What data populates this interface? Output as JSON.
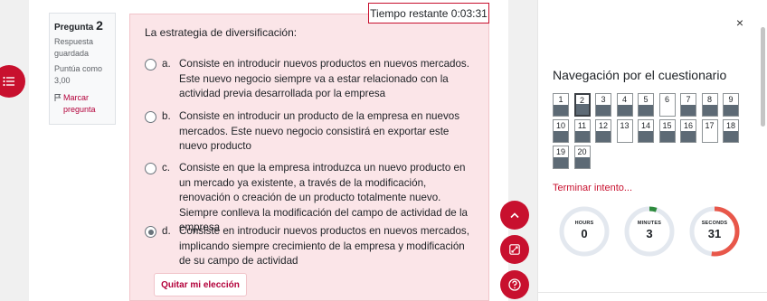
{
  "question_info": {
    "pregunta_label": "Pregunta",
    "number": "2",
    "status": "Respuesta guardada",
    "score": "Puntúa como 3,00",
    "flag_label": "Marcar pregunta"
  },
  "timer": "Tiempo restante 0:03:31",
  "question": {
    "text": "La estrategia de diversificación:",
    "answers": [
      {
        "letter": "a.",
        "text": "Consiste en introducir nuevos productos en nuevos mercados. Este nuevo negocio siempre va a estar relacionado con la actividad previa desarrollada por la empresa",
        "checked": false
      },
      {
        "letter": "b.",
        "text": "Consiste en introducir un producto de la empresa en nuevos mercados. Este nuevo negocio consistirá en exportar este nuevo producto",
        "checked": false
      },
      {
        "letter": "c.",
        "text": "Consiste en que la empresa introduzca un nuevo producto en un mercado ya existente, a través de la modificación, renovación o creación de un producto totalmente nuevo. Siempre conlleva la modificación del campo de actividad de la empresa",
        "checked": false
      },
      {
        "letter": "d.",
        "text": "Consiste en introducir nuevos productos en nuevos mercados, implicando siempre crecimiento de la empresa y modificación de su campo de actividad",
        "checked": true
      }
    ],
    "clear_label": "Quitar mi elección"
  },
  "drawer": {
    "close_glyph": "×",
    "title": "Navegación por el cuestionario",
    "nav": [
      {
        "n": "1",
        "answered": true
      },
      {
        "n": "2",
        "answered": true,
        "current": true
      },
      {
        "n": "3",
        "answered": true
      },
      {
        "n": "4",
        "answered": true
      },
      {
        "n": "5",
        "answered": true
      },
      {
        "n": "6",
        "answered": false
      },
      {
        "n": "7",
        "answered": true
      },
      {
        "n": "8",
        "answered": true
      },
      {
        "n": "9",
        "answered": true
      },
      {
        "n": "10",
        "answered": true
      },
      {
        "n": "11",
        "answered": true
      },
      {
        "n": "12",
        "answered": true
      },
      {
        "n": "13",
        "answered": false
      },
      {
        "n": "14",
        "answered": true
      },
      {
        "n": "15",
        "answered": true
      },
      {
        "n": "16",
        "answered": true
      },
      {
        "n": "17",
        "answered": false
      },
      {
        "n": "18",
        "answered": true
      },
      {
        "n": "19",
        "answered": true
      },
      {
        "n": "20",
        "answered": true
      }
    ],
    "finish_label": "Terminar intento...",
    "countdown": [
      {
        "label": "HOURS",
        "value": "0",
        "fraction": 0.0
      },
      {
        "label": "MINUTES",
        "value": "3",
        "fraction": 0.05
      },
      {
        "label": "SECONDS",
        "value": "31",
        "fraction": 0.52
      }
    ]
  },
  "colors": {
    "accent": "#c8102e",
    "ring_bg": "#e3e8ef",
    "ring_minutes": "#2e8b3e",
    "ring_seconds": "#e8574a"
  },
  "icons": {
    "drawer_toggle": "list-icon",
    "scroll_top": "chevron-up-icon",
    "fullscreen": "expand-icon",
    "help": "question-icon",
    "flag": "flag-icon",
    "close": "close-icon"
  }
}
